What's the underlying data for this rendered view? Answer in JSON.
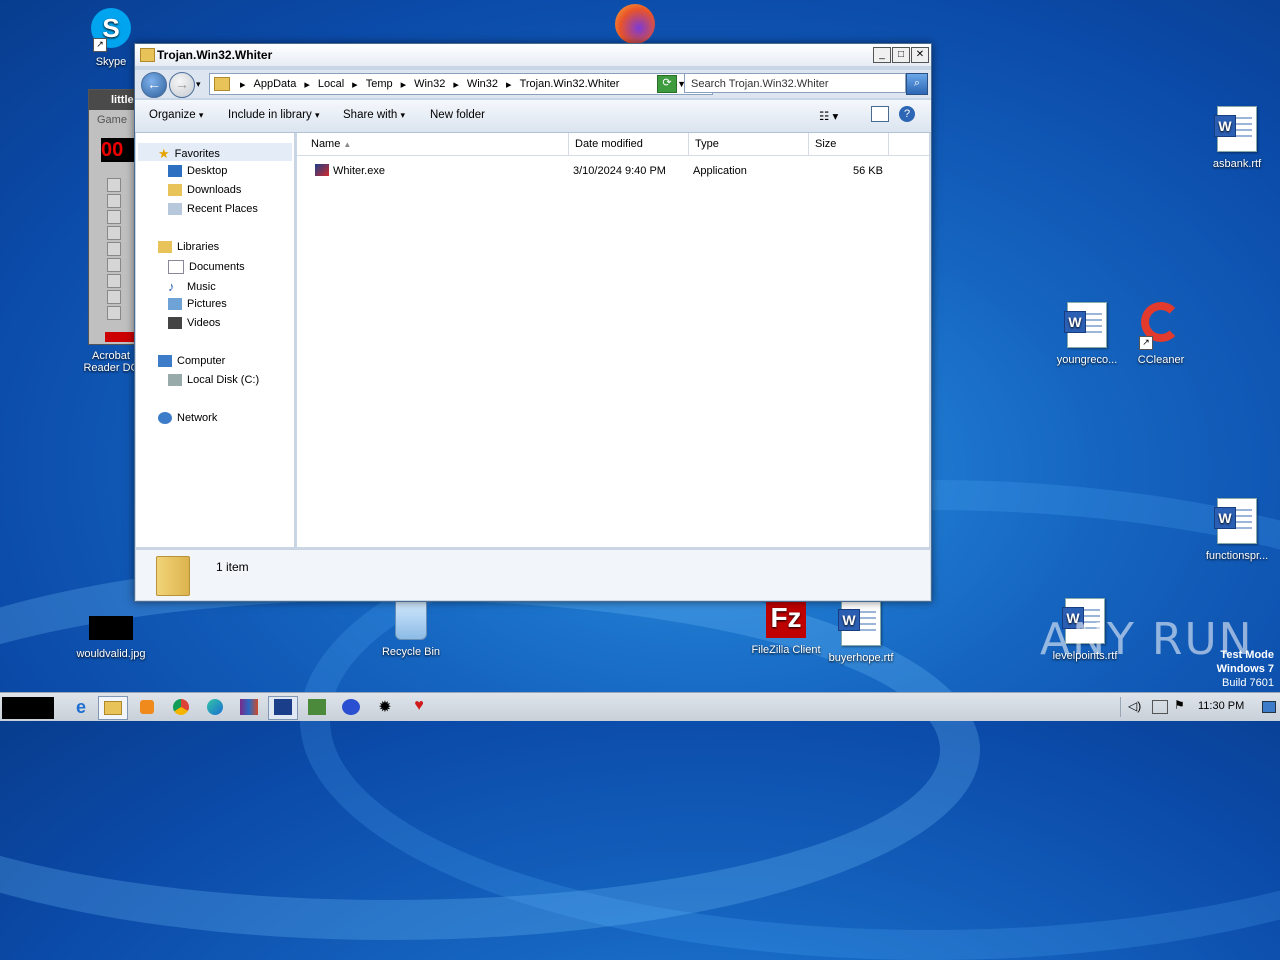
{
  "window": {
    "title": "Trojan.Win32.Whiter",
    "address": [
      "AppData",
      "Local",
      "Temp",
      "Win32",
      "Win32",
      "Trojan.Win32.Whiter"
    ],
    "search_placeholder": "Search Trojan.Win32.Whiter",
    "toolbar": {
      "organize": "Organize",
      "include_library": "Include in library",
      "share_with": "Share with",
      "new_folder": "New folder"
    },
    "nav": {
      "favorites": "Favorites",
      "desktop": "Desktop",
      "downloads": "Downloads",
      "recent": "Recent Places",
      "libraries": "Libraries",
      "documents": "Documents",
      "music": "Music",
      "pictures": "Pictures",
      "videos": "Videos",
      "computer": "Computer",
      "local_disk": "Local Disk (C:)",
      "network": "Network"
    },
    "columns": {
      "name": "Name",
      "date": "Date modified",
      "type": "Type",
      "size": "Size"
    },
    "files": [
      {
        "name": "Whiter.exe",
        "date": "3/10/2024 9:40 PM",
        "type": "Application",
        "size": "56 KB"
      }
    ],
    "status": "1 item"
  },
  "minesweeper": {
    "title": "little",
    "menu": "Game"
  },
  "desktop": {
    "icons": {
      "skype": "Skype",
      "acrobat1": "Acrobat",
      "acrobat2": "Reader DC",
      "asbank": "asbank.rtf",
      "youngreco": "youngreco...",
      "ccleaner": "CCleaner",
      "functionspr": "functionspr...",
      "wouldvalid": "wouldvalid.jpg",
      "recycle": "Recycle Bin",
      "filezilla": "FileZilla Client",
      "buyerhope": "buyerhope.rtf",
      "levelpoints": "levelpoints.rtf"
    },
    "watermark": {
      "line1": "Test Mode",
      "line2": "Windows 7",
      "line3": "Build 7601"
    },
    "brand": "ANY RUN"
  },
  "taskbar": {
    "clock": "11:30 PM"
  }
}
